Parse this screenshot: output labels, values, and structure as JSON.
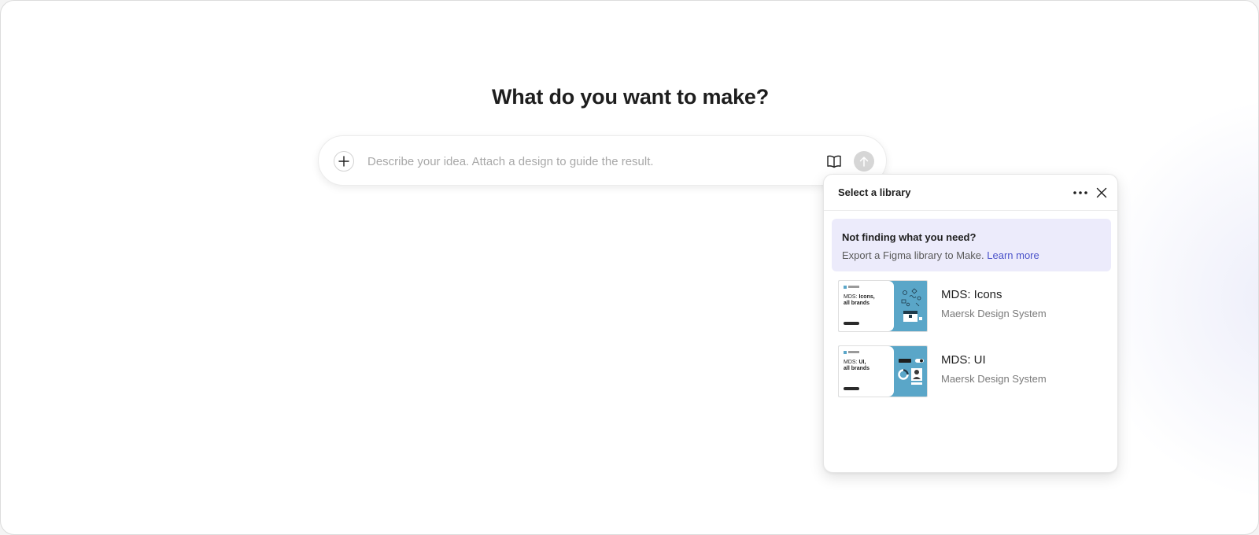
{
  "main": {
    "heading": "What do you want to make?",
    "prompt_placeholder": "Describe your idea. Attach a design to guide the result.",
    "icons": {
      "attach": "plus-icon",
      "library": "book-icon",
      "send": "arrow-up-icon"
    }
  },
  "library_panel": {
    "title": "Select a library",
    "icons": {
      "more": "more-horizontal-icon",
      "close": "close-icon"
    },
    "notice": {
      "title": "Not finding what you need?",
      "body": "Export a Figma library to Make.",
      "link": "Learn more"
    },
    "items": [
      {
        "name": "MDS: Icons",
        "subtitle": "Maersk Design System",
        "thumb_prefix": "MDS: ",
        "thumb_bold": "Icons,",
        "thumb_line2": "all brands"
      },
      {
        "name": "MDS: UI",
        "subtitle": "Maersk Design System",
        "thumb_prefix": "MDS: ",
        "thumb_bold": "UI,",
        "thumb_line2": "all brands"
      }
    ]
  },
  "colors": {
    "accent_link": "#4a52c9",
    "notice_bg": "#ecebfb",
    "thumb_blue": "#5aa6c8",
    "send_disabled": "#d6d6d6"
  }
}
